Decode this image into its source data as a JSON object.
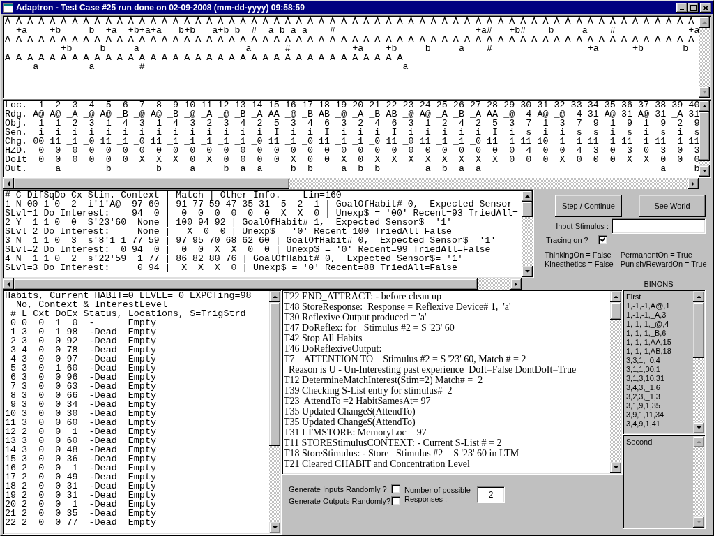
{
  "window": {
    "title": "Adaptron - Test Case #25 run done on 02-09-2008 (mm-dd-yyyy) 09:58:59"
  },
  "sensor_history": {
    "lines": [
      "A A A A A A A A A A A A A A A A A A A A A A A A A A A A A A A A A A A A A A A A A A A A A A A A A A A A A A A A A A A A A A",
      "  +a    +b     b  +a  +b+a+a   b+b   a+b b  #  a b a a    #                         +a#   +b#    b     a    #             +a",
      "A A A A A A A A A A A A A A A A A A A A A A A A A A A A A A A A A A A A A A A A A A A A A A A A A A A A A A A A A A A A A A",
      "          +b     b     a                   a      #           +a    +b     b     a    #                 +a      +b       b",
      "A A A A A A A A A A A A A A A A A A A A A A A A A A A A A A A A A A A A",
      "     a         a        #                                             +a"
    ]
  },
  "location_grid": {
    "lines": [
      "Loc.  1  2  3  4  5  6  7  8  9 10 11 12 13 14 15 16 17 18 19 20 21 22 23 24 25 26 27 28 29 30 31 32 33 34 35 36 37 38 39 40",
      "Rdg. A@ A@ _A _@ A@ _B _@ A@ _B _@ _A _@ _B _A AA _@ _B AB _@ _A _B AB _@ A@ _A _B _A AA _@  4 A@ _@  4 31 A@ 31 A@ 31 _A 31",
      "Obj.  1  1  2  3  1  4  3  1  4  3  2  3  4  2  5  3  4  6  3  2  4  6  3  1  2  4  2  5  3  7  1  3  7  9  1  9  1  9  2  9",
      "Sen.  i  i  i  i  i  i  i  i  i  i  i  i  i  i  I  i  i  I  i  i  i  I  i  i  i  i  i  I  i  s  i  i  s  s  i  s  i  s  i  s",
      "Chg. 00 11 _1 _0 11 _1 _0 11 _1 _1 _1 _1 _1 _0 11 _1 _0 11 _1 _1 _0 11 _0 11 _1 _1 _0 11  1 11 10  1  1 11  1 11  1 11  1 11",
      "HZD.  0  0  0  0  0  0  0  0  0  0  0  0  0  0  0  0  0  0  0  0  0  0  0  0  0  0  0  0  0  4  0  0  4  3  0  3  0  3  0  3",
      "DoIt  0  0  0  0  0  0  X  X  X  0  X  0  0  0  0  X  0  0  X  0  X  X  X  X  X  X  X  X  0  0  0  X  0  0  0  X  X  0  0  0",
      "Out.     a        b        b     a     b  a  a     b  b     a  b  b        a  b  a  a                                a     b"
    ]
  },
  "context_list": {
    "lines": [
      "# C DifSqDo Cx Stim. Context | Match | Other Info.    Lin=160",
      "1 N 00 1 0  2  i'1'A@  97 60 | 91 77 59 47 35 31  5  2  1 | GoalOfHabit# 0,  Expected Sensor",
      "SLvl=1 Do Interest:    94  0 |  0  0  0  0  0  0  X  X  0 | Unexp$ = '00' Recent=93 TriedAll=",
      "2 Y  1 1 0  0  S'23'60  None | 100 94 92 | GoalOfHabit# 1,  Expected Sensor$= '1'",
      "SLvl=2 Do Interest:     None |   X  0  0 | Unexp$ = '0' Recent=100 TriedAll=False",
      "3 N  1 1 0  3  s'8'1 1 77 59 | 97 95 70 68 62 60 | GoalOfHabit# 0,  Expected Sensor$= '1'",
      "SLvl=2 Do Interest:  0 94  0 |  0  0  X  X  0  0 | Unexp$ = '0' Recent=99 TriedAll=False",
      "4 N  1 1 0  2  s'22'59  1 77 | 86 82 80 76 | GoalOfHabit# 0,  Expected Sensor$= '1'",
      "SLvl=3 Do Interest:     0 94 |  X  X  X  0 | Unexp$ = '0' Recent=88 TriedAll=False"
    ]
  },
  "controls": {
    "buttons": [
      {
        "label": "Step / Continue"
      },
      {
        "label": "See World"
      }
    ],
    "input_stimulus": {
      "label": "Input Stimulus :"
    },
    "tracing": {
      "label": "Tracing on ?",
      "checked": true
    },
    "flags": [
      "ThinkingOn = False",
      "PermanentOn = True",
      "Kinesthetics = False",
      "Punish/RewardOn = True"
    ]
  },
  "habits": {
    "lines": [
      "Habits, Current HABIT=0 LEVEL= 0 EXPCTing=98",
      "  No, Context & InterestLevel",
      " # L Cxt DoEx Status, Locations, S=TrigStrd",
      " 0 0  0  1  0  -      Empty",
      " 1 3  0  1 98  -Dead  Empty",
      " 2 3  0  0 92  -Dead  Empty",
      " 3 4  0  0 78  -Dead  Empty",
      " 4 3  0  0 97  -Dead  Empty",
      " 5 3  0  1 60  -Dead  Empty",
      " 6 3  0  0 96  -Dead  Empty",
      " 7 3  0  0 63  -Dead  Empty",
      " 8 3  0  0 66  -Dead  Empty",
      " 9 3  0  0 34  -Dead  Empty",
      "10 3  0  0 30  -Dead  Empty",
      "11 3  0  0 60  -Dead  Empty",
      "12 2  0  0  1  -Dead  Empty",
      "13 3  0  0 60  -Dead  Empty",
      "14 3  0  0 48  -Dead  Empty",
      "15 3  0  0 36  -Dead  Empty",
      "16 2  0  0  1  -Dead  Empty",
      "17 2  0  0 49  -Dead  Empty",
      "18 2  0  0 31  -Dead  Empty",
      "19 2  0  0 31  -Dead  Empty",
      "20 2  0  0  1  -Dead  Empty",
      "21 2  0  0 35  -Dead  Empty",
      "22 2  0  0 77  -Dead  Empty"
    ]
  },
  "trace_log": {
    "lines": [
      "T22 END_ATTRACT: - before clean up",
      "T48 StoreResponse:  Response = Reflexive Device# 1,  'a'",
      "T30 Reflexive Output produced = 'a'",
      "T47 DoReflex: for   Stimulus #2 = S '23' 60",
      "T42 Stop All Habits",
      "T46 DoReflexiveOutput:",
      "T7    ATTENTION TO    Stimulus #2 = S '23' 60, Match # = 2",
      "  Reason is U - Un-Interesting past experience  DoIt=False DontDoIt=True",
      "T12 DetermineMatchInterest(Stim=2) Match# =  2",
      "T39 Checking S-List entry for stimulus#  2",
      "T23  AttendTo =2 HabitSamesAt= 97",
      "T35 Updated Change$(AttendTo)",
      "T35 Updated Change$(AttendTo)",
      "T31 LTMSTORE: MemoryLoc = 97",
      "T11 STOREStimulusCONTEXT: - Current S-List # = 2",
      "T18 StoreStimulus: - Store   Stimulus #2 = S '23' 60 in LTM",
      "T21 Cleared CHABIT and Concentration Level"
    ]
  },
  "randomize": {
    "options": [
      {
        "label": "Generate Inputs Randomly ?",
        "checked": false
      },
      {
        "label": "Generate Outputs Randomly?",
        "checked": false
      }
    ],
    "responses": {
      "label": "Number of possible Responses :",
      "value": "2"
    }
  },
  "binons": {
    "title": "BINONS",
    "lists": [
      {
        "title": "First",
        "items": [
          "1,-1,-1,A@,1",
          "1,-1,-1,_A,3",
          "1,-1,-1,_@,4",
          "1,-1,-1,_B,6",
          "1,-1,-1,AA,15",
          "1,-1,-1,AB,18",
          "3,3,1,_0,4",
          "3,1,1,00,1",
          "3,1,3,10,31",
          "3,4,3,_1,6",
          "3,2,3,_1,3",
          "3,1,9,1,35",
          "3,9,1,11,34",
          "3,4,9,1,41"
        ]
      },
      {
        "title": "Second"
      }
    ]
  }
}
